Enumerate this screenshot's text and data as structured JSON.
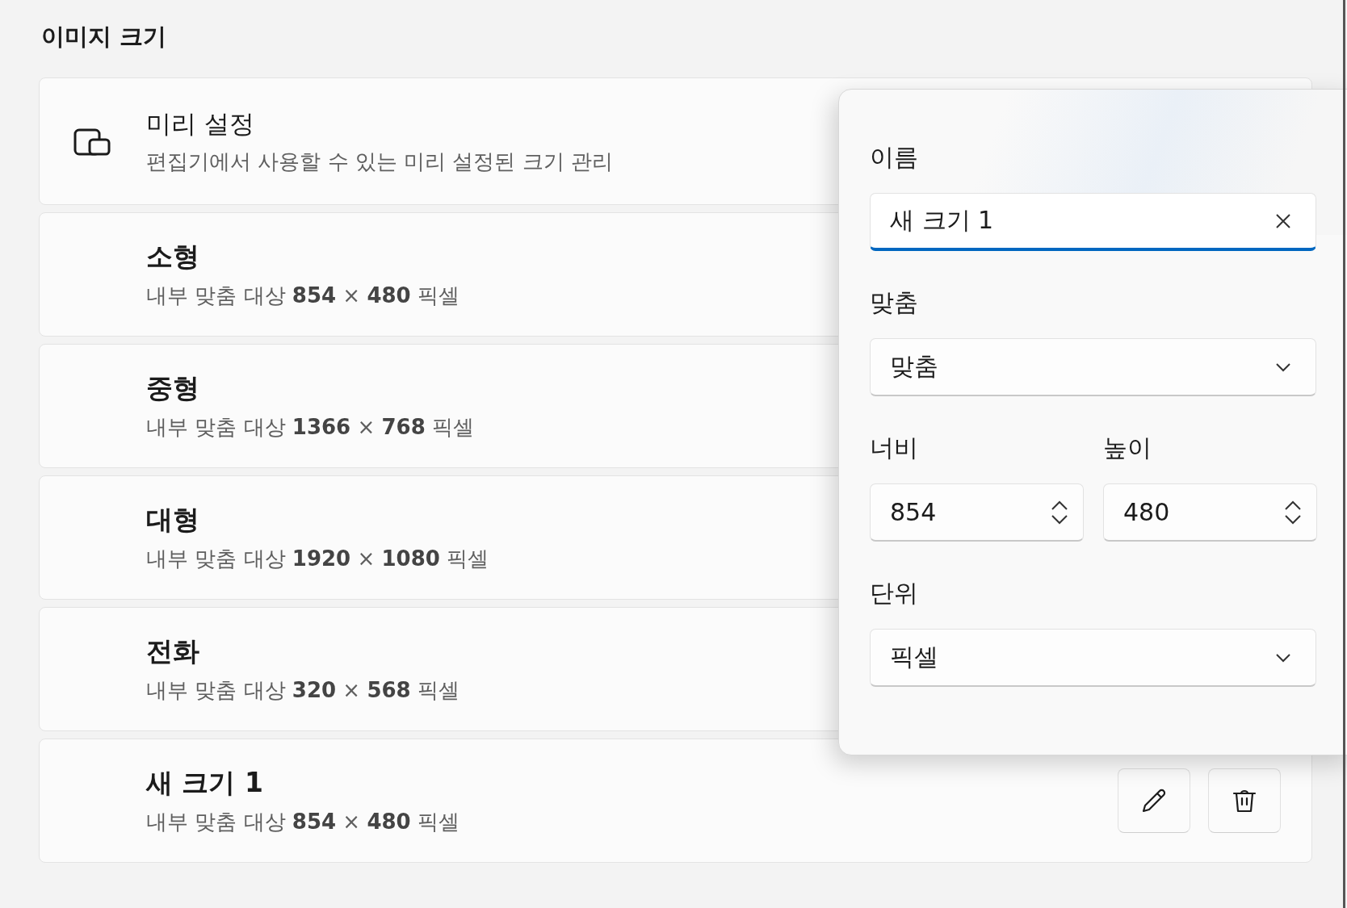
{
  "section_title": "이미지 크기",
  "preset_header": {
    "title": "미리 설정",
    "description": "편집기에서 사용할 수 있는 미리 설정된 크기 관리"
  },
  "presets": [
    {
      "name": "소형",
      "detail": "내부 맞춤 대상 **854** × **480** 픽셀"
    },
    {
      "name": "중형",
      "detail": "내부 맞춤 대상 **1366** × **768** 픽셀"
    },
    {
      "name": "대형",
      "detail": "내부 맞춤 대상 **1920** × **1080** 픽셀"
    },
    {
      "name": "전화",
      "detail": "내부 맞춤 대상 **320** × **568** 픽셀"
    },
    {
      "name": "새 크기 1",
      "detail": "내부 맞춤 대상 **854** × **480** 픽셀",
      "actions": true
    }
  ],
  "editor": {
    "name": {
      "label": "이름",
      "value": "새 크기 1",
      "focused": true
    },
    "fit": {
      "label": "맞춤",
      "value": "맞춤"
    },
    "width": {
      "label": "너비",
      "value": "854"
    },
    "height": {
      "label": "높이",
      "value": "480"
    },
    "unit": {
      "label": "단위",
      "value": "픽셀"
    }
  }
}
